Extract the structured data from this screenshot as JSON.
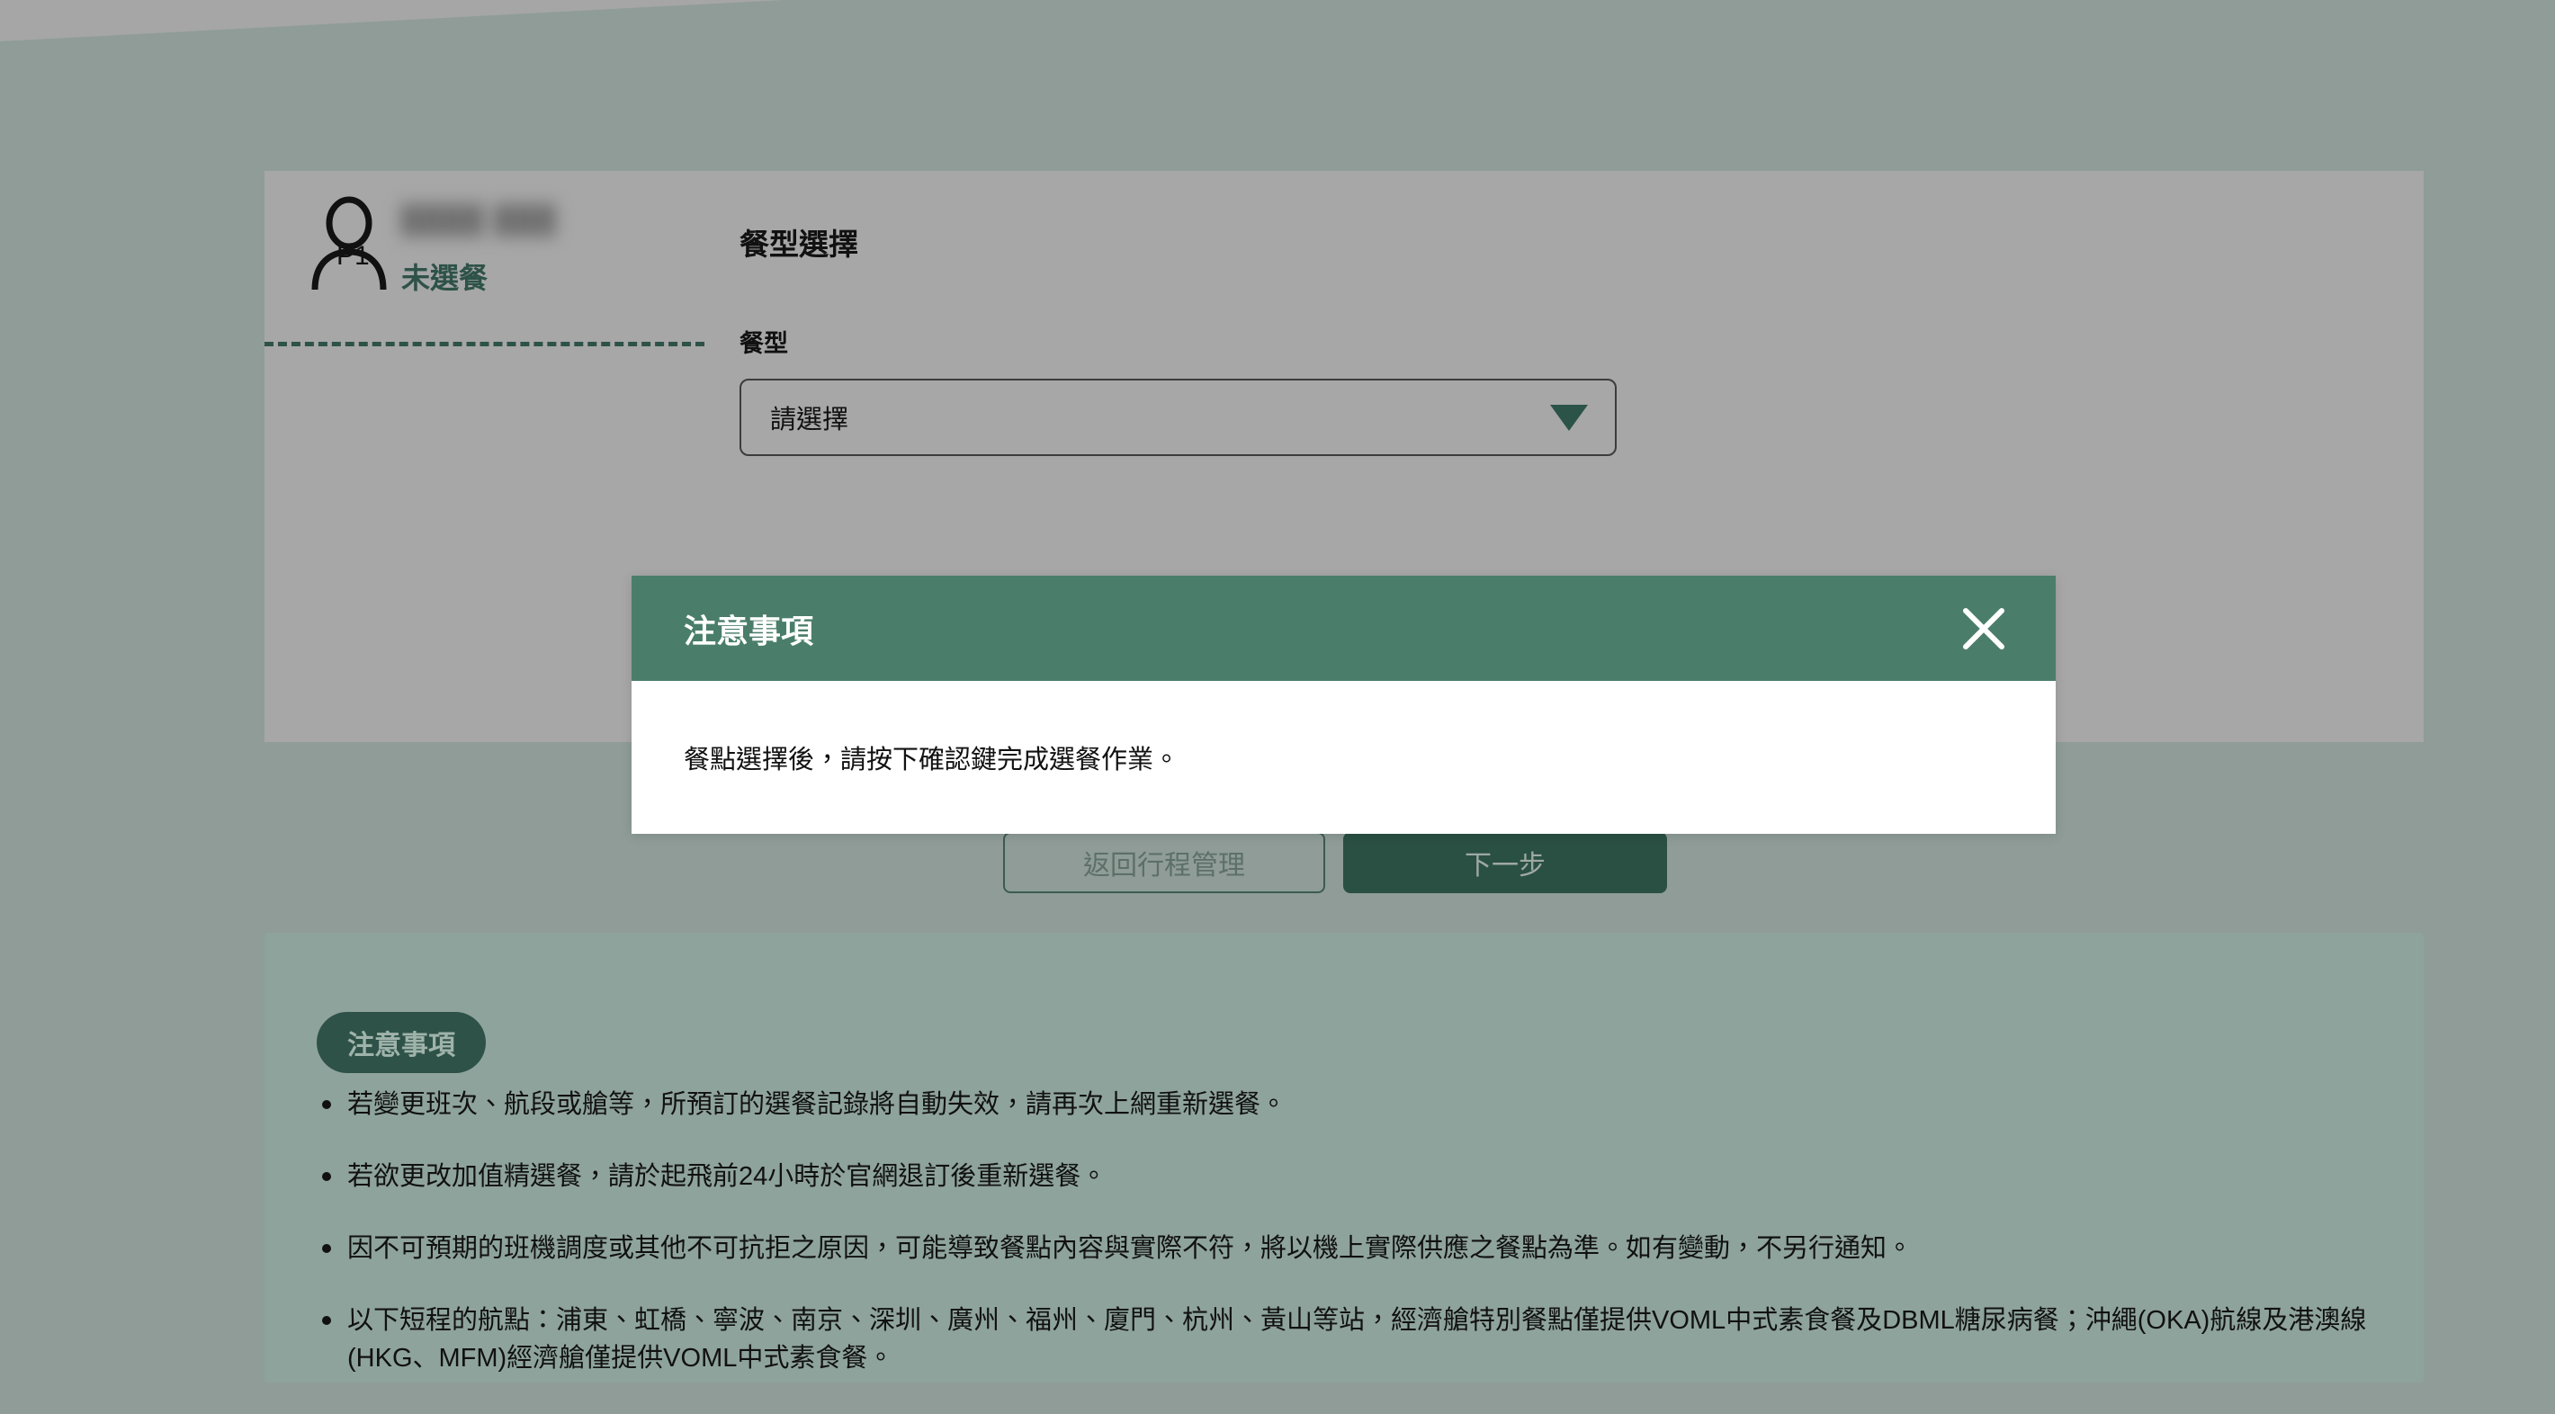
{
  "colors": {
    "page_bg": "#8f9c98",
    "card_bg": "#a7a7a7",
    "brand_green": "#2e5248",
    "modal_header_green": "#4a7e6b",
    "primary_button_green": "#2a5043",
    "notices_bg": "#8ea39c"
  },
  "passenger": {
    "code": "P1",
    "name_masked": "",
    "status": "未選餐"
  },
  "meal": {
    "section_title": "餐型選擇",
    "field_label": "餐型",
    "select_value": "請選擇",
    "select_placeholder": "請選擇"
  },
  "actions": {
    "back_label": "返回行程管理",
    "next_label": "下一步"
  },
  "modal": {
    "title": "注意事項",
    "body": "餐點選擇後，請按下確認鍵完成選餐作業。",
    "close_icon": "close-icon"
  },
  "notices": {
    "badge": "注意事項",
    "items": [
      "若變更班次、航段或艙等，所預訂的選餐記錄將自動失效，請再次上網重新選餐。",
      "若欲更改加值精選餐，請於起飛前24小時於官網退訂後重新選餐。",
      "因不可預期的班機調度或其他不可抗拒之原因，可能導致餐點內容與實際不符，將以機上實際供應之餐點為準。如有變動，不另行通知。",
      "以下短程的航點：浦東、虹橋、寧波、南京、深圳、廣州、福州、廈門、杭州、黃山等站，經濟艙特別餐點僅提供VOML中式素食餐及DBML糖尿病餐；沖繩(OKA)航線及港澳線(HKG、MFM)經濟艙僅提供VOML中式素食餐。"
    ]
  }
}
